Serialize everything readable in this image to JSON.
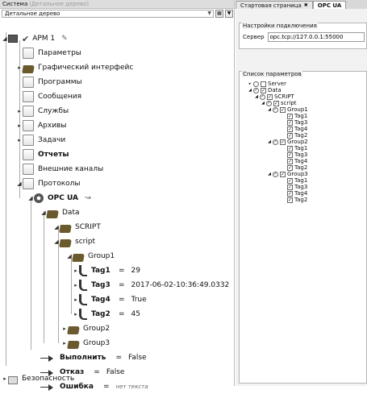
{
  "left": {
    "header_title": "Система",
    "header_subtitle": "(Детальное дерево)",
    "view_select": "Детальное дерево",
    "tree": {
      "arm": "АРМ 1",
      "items": [
        "Параметры",
        "Графический интерфейс",
        "Программы",
        "Сообщения",
        "Службы",
        "Архивы",
        "Задачи",
        "Отчеты",
        "Внешние каналы",
        "Протоколы"
      ],
      "opc": "OPC UA",
      "data": "Data",
      "script_upper": "SCRIPT",
      "script_lower": "script",
      "group1": "Group1",
      "group2": "Group2",
      "group3": "Group3",
      "tags": [
        {
          "name": "Tag1",
          "value": "29"
        },
        {
          "name": "Tag3",
          "value": "2017-06-02-10:36:49.0332"
        },
        {
          "name": "Tag4",
          "value": "True"
        },
        {
          "name": "Tag2",
          "value": "45"
        }
      ],
      "equals": "=",
      "execute": {
        "label": "Выполнить",
        "value": "False"
      },
      "fail": {
        "label": "Отказ",
        "value": "False"
      },
      "error": {
        "label": "Ошибка",
        "value": "нет текста"
      },
      "security": "Безопасность"
    }
  },
  "right": {
    "tabs": [
      "Стартовая страница",
      "OPC UA"
    ],
    "conn_title": "Настройки подключения",
    "server_label": "Сервер",
    "server_value": "opc.tcp://127.0.0.1:55000",
    "params_title": "Список параметров",
    "params": {
      "server": "Server",
      "data": "Data",
      "script_upper": "SCRIPT",
      "script_lower": "script",
      "groups": [
        "Group1",
        "Group2",
        "Group3"
      ],
      "tags": [
        "Tag1",
        "Tag3",
        "Tag4",
        "Tag2"
      ]
    }
  }
}
